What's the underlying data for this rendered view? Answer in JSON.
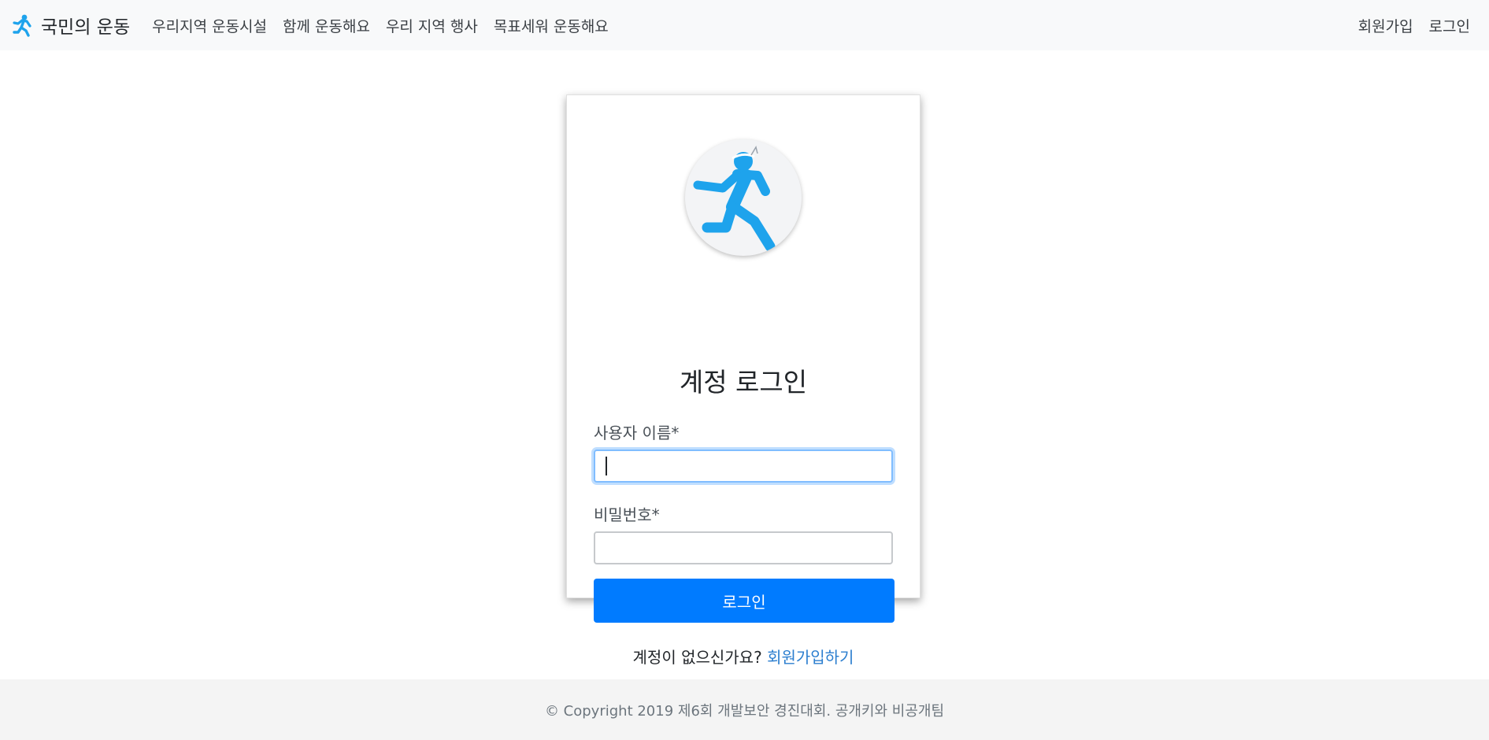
{
  "navbar": {
    "brand": "국민의 운동",
    "brand_icon": "running-person-icon",
    "links": [
      "우리지역 운동시설",
      "함께 운동해요",
      "우리 지역 행사",
      "목표세워 운동해요"
    ],
    "right_links": [
      "회원가입",
      "로그인"
    ]
  },
  "login": {
    "avatar_icon": "running-person-icon",
    "title": "계정 로그인",
    "username_label": "사용자 이름*",
    "username_value": "",
    "password_label": "비밀번호*",
    "password_value": "",
    "submit_label": "로그인",
    "signup_prompt": "계정이 없으신가요?",
    "signup_link": "회원가입하기"
  },
  "footer": {
    "text": "© Copyright 2019 제6회 개발보안 경진대회. 공개키와 비공개팀"
  },
  "colors": {
    "accent": "#007bff",
    "icon_blue": "#1ea3ec",
    "navbar_bg": "#f8f9fa",
    "footer_bg": "#f4f4f4"
  }
}
